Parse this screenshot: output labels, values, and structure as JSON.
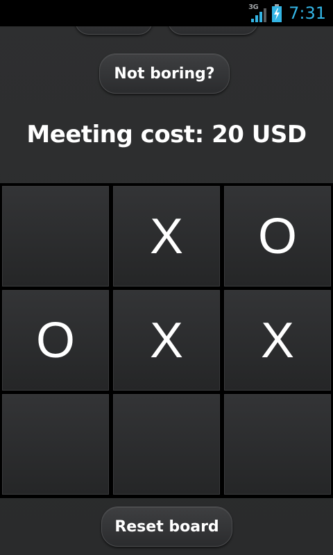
{
  "status_bar": {
    "network": "3G",
    "time": "7:31"
  },
  "buttons": {
    "not_boring": "Not boring?",
    "reset_board": "Reset board"
  },
  "meeting_cost": "Meeting cost: 20 USD",
  "board": {
    "cells": [
      "",
      "X",
      "O",
      "O",
      "X",
      "X",
      "",
      "",
      ""
    ]
  },
  "colors": {
    "clock": "#33b5e5",
    "background": "#2b2c2d",
    "board_lines": "#000000"
  }
}
